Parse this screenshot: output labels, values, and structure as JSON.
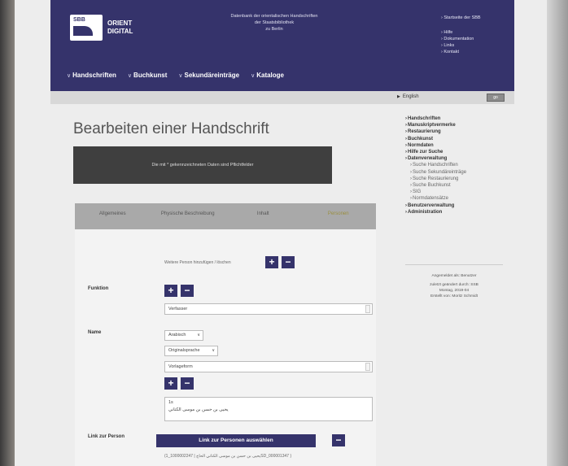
{
  "header": {
    "logo_line1": "SBB",
    "logo_line2": "ORIENT",
    "logo_line3": "DIGITAL",
    "title_line1": "Datenbank der orientalischen Handschriften",
    "title_line2": "der Staatsbibliothek",
    "title_line3": "zu Berlin",
    "quicklinks": [
      "› Startseite der SBB",
      "› Hilfe",
      "› Dokumentation",
      "› Links",
      "› Kontakt"
    ],
    "nav": [
      "Handschriften",
      "Buchkunst",
      "Sekundäreinträge",
      "Kataloge"
    ],
    "language": "English",
    "language_button": "go"
  },
  "main": {
    "page_title": "Bearbeiten einer Handschrift",
    "info_text": "Die mit * gekennzeichneten Daten sind Pflichtfelder",
    "tabs": [
      {
        "label": "Allgemeines"
      },
      {
        "label": "Physische Beschreibung"
      },
      {
        "label": "Inhalt"
      },
      {
        "label": "Personen"
      }
    ],
    "add_person_text": "Weitere Person hinzufügen / löschen",
    "funktion_label": "Funktion",
    "funktion_value": "Verfasser",
    "name_label": "Name",
    "script_select": "Arabisch",
    "language_select": "Originalsprache",
    "form_value": "Vorlageform",
    "textarea_line1": "1s",
    "textarea_line2": "يحيى بن حسن بن موسى الكتاني",
    "link_label": "Link zur Person",
    "link_button": "Link zur Personen auswählen",
    "link_result": "(يحيى بن حسن بن موسى الكتاني الحاج | 1000002247_1SD_000001347 )"
  },
  "sidebar": {
    "items": [
      {
        "label": "Handschriften",
        "type": "top"
      },
      {
        "label": "Manuskriptvermerke",
        "type": "top"
      },
      {
        "label": "Restaurierung",
        "type": "top"
      },
      {
        "label": "Buchkunst",
        "type": "top"
      },
      {
        "label": "Normdaten",
        "type": "top"
      },
      {
        "label": "Hilfe zur Suche",
        "type": "top"
      },
      {
        "label": "Datenverwaltung",
        "type": "top"
      },
      {
        "label": "Suche Handschriften",
        "type": "sub"
      },
      {
        "label": "Suche Sekundäreinträge",
        "type": "sub"
      },
      {
        "label": "Suche Restaurierung",
        "type": "sub"
      },
      {
        "label": "Suche Buchkunst",
        "type": "sub"
      },
      {
        "label": "SIG",
        "type": "sub"
      },
      {
        "label": "Normdatensätze",
        "type": "sub"
      },
      {
        "label": "Benutzerverwaltung",
        "type": "top"
      },
      {
        "label": "Administration",
        "type": "top"
      }
    ],
    "user_line1": "Angemeldet als: Benutzer",
    "user_line2": "zuletzt geändert durch: SSB",
    "user_line3": "Montag, 2019-04",
    "user_line4": "Erstellt von: Moritz Schmidt"
  }
}
